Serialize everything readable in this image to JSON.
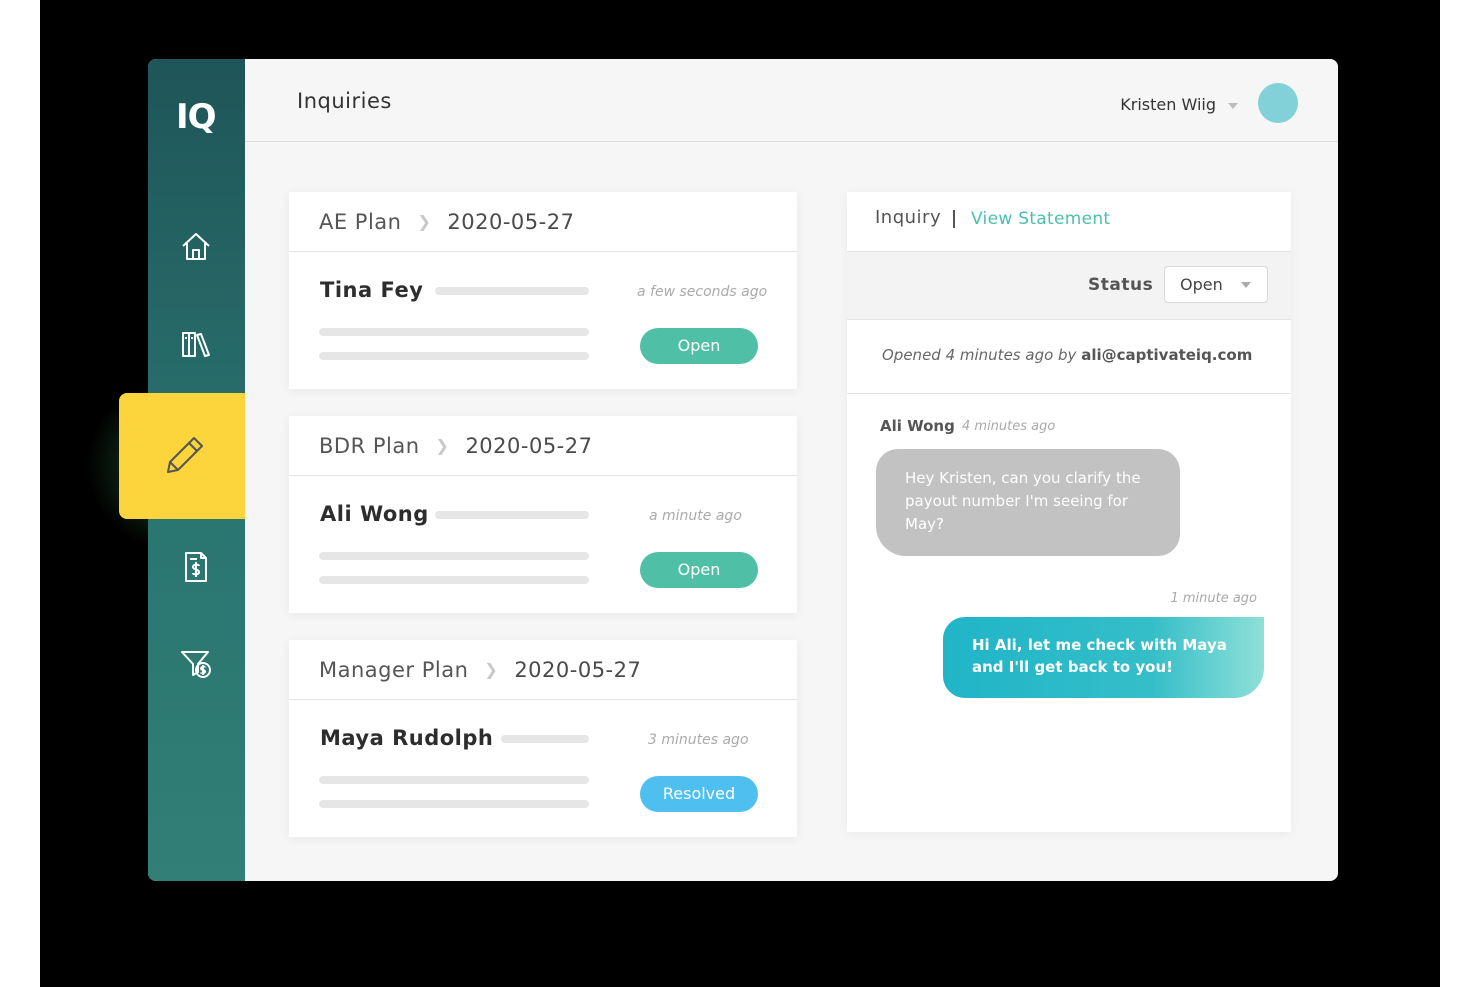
{
  "app": {
    "logo": "IQ",
    "page_title": "Inquiries",
    "user_name": "Kristen Wiig"
  },
  "sidebar": {
    "items": [
      {
        "icon": "home-icon",
        "active": false
      },
      {
        "icon": "library-icon",
        "active": false
      },
      {
        "icon": "pencil-icon",
        "active": true
      },
      {
        "icon": "statement-icon",
        "active": false
      },
      {
        "icon": "filter-dollar-icon",
        "active": false
      }
    ]
  },
  "inquiries": [
    {
      "plan": "AE Plan",
      "date": "2020-05-27",
      "person": "Tina Fey",
      "time": "a few seconds ago",
      "status": "Open"
    },
    {
      "plan": "BDR Plan",
      "date": "2020-05-27",
      "person": "Ali Wong",
      "time": "a minute ago",
      "status": "Open"
    },
    {
      "plan": "Manager Plan",
      "date": "2020-05-27",
      "person": "Maya Rudolph",
      "time": "3 minutes ago",
      "status": "Resolved"
    }
  ],
  "panel": {
    "tab_inquiry": "Inquiry",
    "tab_view_statement": "View Statement",
    "status_label": "Status",
    "status_value": "Open",
    "opened_prefix": "Opened 4 minutes ago by ",
    "opened_email": "ali@captivateiq.com",
    "messages": [
      {
        "author": "Ali Wong",
        "time": "4 minutes ago",
        "text": "Hey Kristen, can you clarify the payout number I'm seeing for May?"
      },
      {
        "author": "",
        "time": "1 minute ago",
        "text": "Hi Ali, let me check with Maya and I'll get back to you!"
      }
    ]
  },
  "colors": {
    "sidebar": "#2a7570",
    "active_tile": "#fcd43b",
    "open_pill": "#4fc0a6",
    "resolved_pill": "#4fbff0",
    "link": "#4bbfae",
    "avatar": "#82d0d8"
  }
}
